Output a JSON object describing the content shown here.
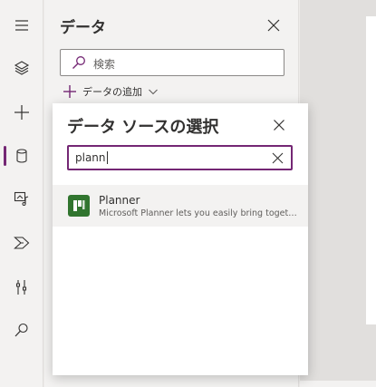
{
  "rail": {
    "items": [
      {
        "icon": "hamburger-menu-icon"
      },
      {
        "icon": "layers-icon"
      },
      {
        "icon": "plus-icon"
      },
      {
        "icon": "database-icon",
        "active": true
      },
      {
        "icon": "media-icon"
      },
      {
        "icon": "power-automate-icon"
      },
      {
        "icon": "tools-icon"
      },
      {
        "icon": "search-icon"
      }
    ]
  },
  "data_panel": {
    "title": "データ",
    "search_placeholder": "検索",
    "add_data_label": "データの追加"
  },
  "dialog": {
    "title": "データ ソースの選択",
    "search_value": "plann",
    "results": [
      {
        "name": "Planner",
        "description": "Microsoft Planner lets you easily bring together teams, tasks, documents, and conversations for better results.",
        "icon_color": "#31752f"
      }
    ]
  },
  "colors": {
    "accent": "#742774",
    "planner_green": "#31752f"
  }
}
